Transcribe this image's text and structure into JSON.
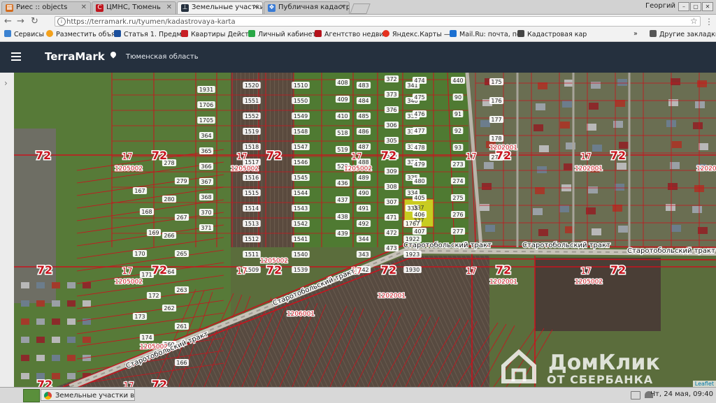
{
  "browser": {
    "tabs": [
      {
        "title": "Риес :: objects",
        "favicon_color": "#d36b1c",
        "active": false
      },
      {
        "title": "ЦМНС, Тюмень",
        "favicon_color": "#c0161e",
        "active": false
      },
      {
        "title": "Земельные участки в",
        "favicon_color": "#25303e",
        "active": true
      },
      {
        "title": "Публичная кадастро",
        "favicon_color": "#3a7bd5",
        "active": false
      }
    ],
    "profile_name": "Георгий",
    "url": "https://terramark.ru/tyumen/kadastrovaya-karta",
    "bookmarks": [
      {
        "label": "Сервисы",
        "color": "#3b82d1"
      },
      {
        "label": "Разместить объя",
        "color": "#f4a11b"
      },
      {
        "label": "Статья 1. Предме",
        "color": "#1a4f9c"
      },
      {
        "label": "Квартиры Дейст",
        "color": "#c81f25"
      },
      {
        "label": "Личный кабинет",
        "color": "#28a745"
      },
      {
        "label": "Агентство недви",
        "color": "#b5121b"
      },
      {
        "label": "Яндекс.Карты —",
        "color": "#e5311f"
      },
      {
        "label": "Mail.Ru: почта, по",
        "color": "#1b6fd1"
      },
      {
        "label": "Кадастровая кар",
        "color": "#444444"
      },
      {
        "label": "Другие закладки",
        "color": "#555555"
      }
    ]
  },
  "app": {
    "logo": "TerraMark",
    "region": "Тюменская область",
    "header_color": "#25303e"
  },
  "map": {
    "zone_labels": [
      "72",
      "72",
      "72",
      "72",
      "72",
      "72",
      "72",
      "72",
      "72",
      "72",
      "72",
      "72",
      "72",
      "72"
    ],
    "district_labels": [
      "17",
      "17",
      "17",
      "17",
      "17",
      "17",
      "17",
      "17",
      "17",
      "17",
      "17"
    ],
    "quarter_labels": [
      "1205002",
      "1205002",
      "1205002",
      "1205002",
      "1205002",
      "1202001",
      "1202001",
      "1202001",
      "1202001",
      "1205002",
      "1206001",
      "1205002",
      "1202001"
    ],
    "road_labels": [
      "Старотобольский тракт",
      "Старотобольский тракт",
      "Старотобольский тракт",
      "Старотобольский тракт",
      "Старотобольский тракт"
    ],
    "parcel_numbers": [
      "1520",
      "1551",
      "1552",
      "1519",
      "1518",
      "1517",
      "1516",
      "1515",
      "1514",
      "1513",
      "1512",
      "1511",
      "1509",
      "1510",
      "1550",
      "1549",
      "1548",
      "1547",
      "1546",
      "1545",
      "1544",
      "1543",
      "1542",
      "1541",
      "1540",
      "1539",
      "483",
      "484",
      "485",
      "486",
      "487",
      "488",
      "489",
      "490",
      "491",
      "492",
      "344",
      "343",
      "342",
      "341",
      "340",
      "339",
      "338",
      "337",
      "336",
      "335",
      "334",
      "333",
      "1767",
      "1922",
      "1923",
      "1930",
      "1931",
      "1706",
      "1705",
      "364",
      "365",
      "366",
      "367",
      "368",
      "370",
      "371",
      "372",
      "373",
      "376",
      "306",
      "305",
      "310",
      "309",
      "308",
      "307",
      "471",
      "472",
      "473",
      "474",
      "475",
      "476",
      "477",
      "478",
      "479",
      "480",
      "405",
      "406",
      "407",
      "408",
      "409",
      "410",
      "518",
      "519",
      "520",
      "436",
      "437",
      "438",
      "439",
      "440",
      "90",
      "91",
      "92",
      "93",
      "273",
      "274",
      "275",
      "276",
      "277",
      "278",
      "279",
      "280",
      "267",
      "266",
      "265",
      "264",
      "263",
      "262",
      "261",
      "260",
      "166",
      "167",
      "168",
      "169",
      "170",
      "171",
      "172",
      "173",
      "174",
      "175",
      "176",
      "177",
      "178",
      "279"
    ],
    "highlight_parcels": [
      "337",
      "337"
    ],
    "highlight_color": "#dcdc1e",
    "boundary_color": "#c8141e",
    "watermark_title": "ДомКлик",
    "watermark_sub": "ОТ СБЕРБАНКА",
    "attribution": "Leaflet"
  },
  "taskbar": {
    "task_label": "Земельные участки в Тю...",
    "clock": "Чт, 24 мая, 09:40"
  }
}
